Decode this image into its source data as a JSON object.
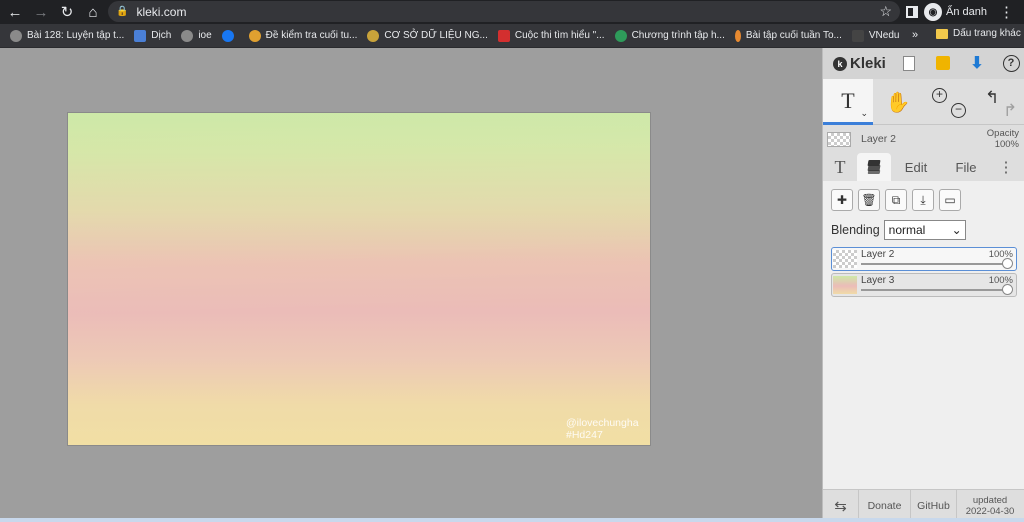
{
  "browser": {
    "url": "kleki.com",
    "profile_label": "Ẩn danh",
    "bookmarks": [
      {
        "label": "Bài 128: Luyện tập t...",
        "color": "#8a8a8a"
      },
      {
        "label": "Dịch",
        "color": "#4a7fd6"
      },
      {
        "label": "ioe",
        "color": "#8a8a8a"
      },
      {
        "label": "",
        "color": "#1877f2"
      },
      {
        "label": "Đề kiểm tra cuối tu...",
        "color": "#e0a030"
      },
      {
        "label": "CƠ SỞ DỮ LIỆU NG...",
        "color": "#c9a33a"
      },
      {
        "label": "Cuộc thi tìm hiểu \"...",
        "color": "#d32f2f"
      },
      {
        "label": "Chương trình tập h...",
        "color": "#2e9b5a"
      },
      {
        "label": "Bài tập cuối tuần To...",
        "color": "#e88a30"
      },
      {
        "label": "VNedu",
        "color": "#444"
      }
    ],
    "bookmarks_more": "»",
    "other_bookmarks": "Dấu trang khác"
  },
  "canvas": {
    "watermark_line1": "@ilovechungha",
    "watermark_line2": "#Hd247"
  },
  "panel": {
    "logo": "Kleki",
    "current_layer": "Layer 2",
    "opacity_label": "Opacity",
    "opacity_value": "100%",
    "tabs": {
      "edit": "Edit",
      "file": "File"
    },
    "blending_label": "Blending",
    "blending_value": "normal",
    "layers": [
      {
        "name": "Layer 2",
        "opacity": "100%",
        "active": true
      },
      {
        "name": "Layer 3",
        "opacity": "100%",
        "active": false
      }
    ],
    "footer": {
      "donate": "Donate",
      "github": "GitHub",
      "updated_label": "updated",
      "updated_date": "2022-04-30"
    }
  }
}
